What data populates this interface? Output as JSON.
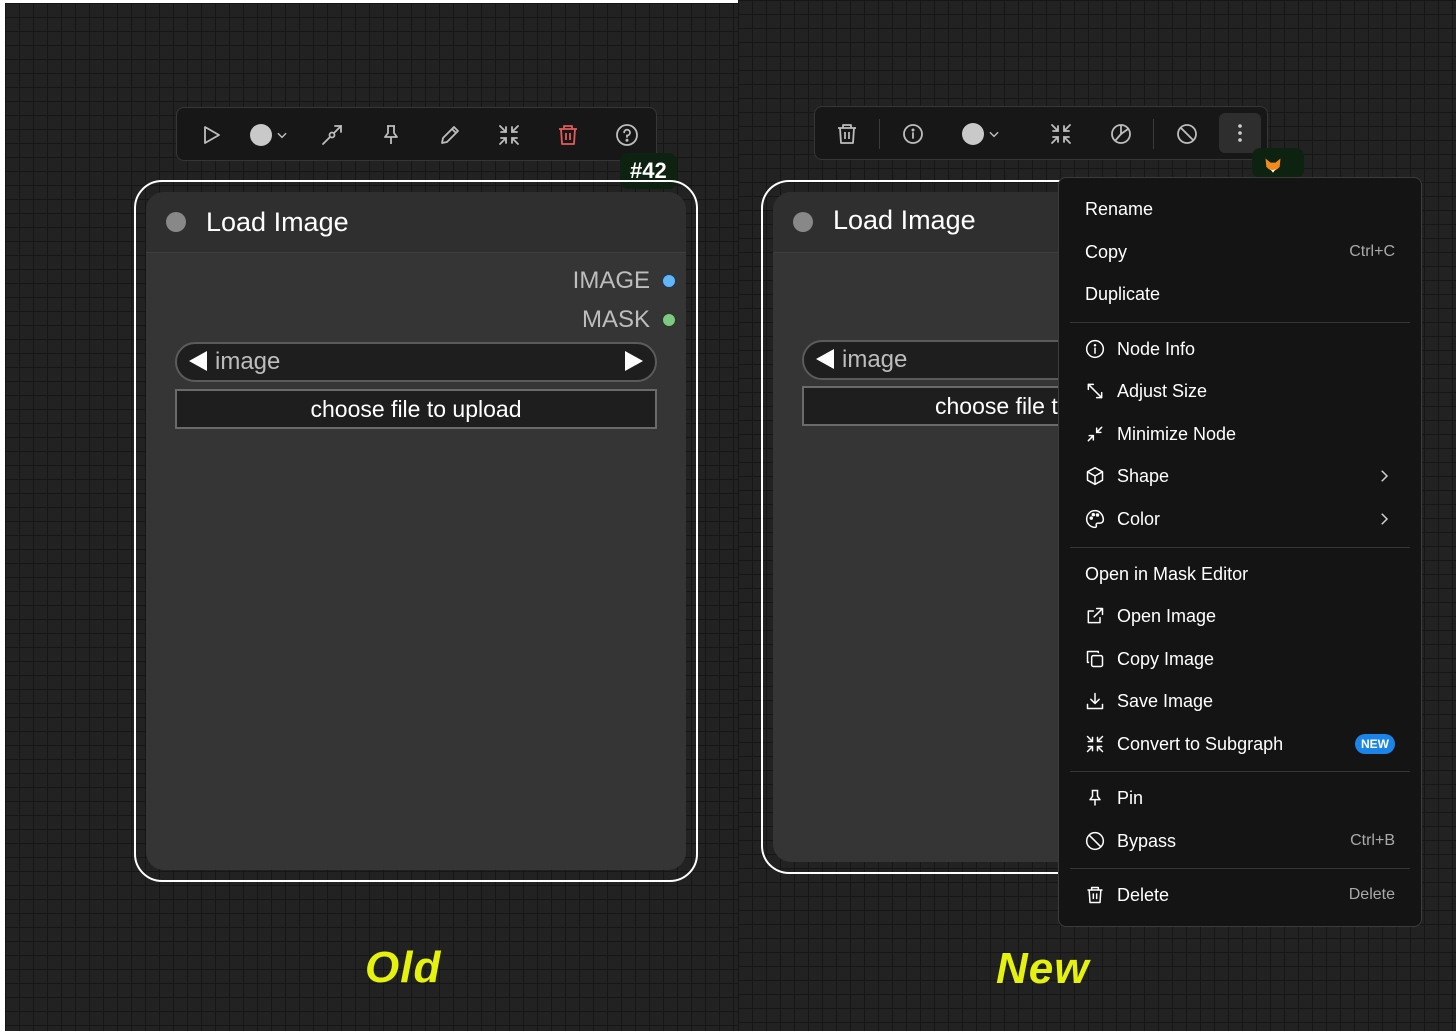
{
  "old": {
    "badge": "#42",
    "node": {
      "title": "Load Image",
      "outputs": [
        {
          "label": "IMAGE",
          "color": "#64b5f6"
        },
        {
          "label": "MASK",
          "color": "#81c784"
        }
      ],
      "combo_label": "image",
      "upload_label": "choose file to upload"
    },
    "caption": "Old",
    "toolbar_icons": [
      "play-icon",
      "color-circle-icon",
      "pen-link-icon",
      "pin-icon",
      "pencil-icon",
      "collapse-icon",
      "trash-icon",
      "help-icon"
    ]
  },
  "new": {
    "node": {
      "title": "Load Image",
      "combo_label": "image",
      "upload_label": "choose file to upload"
    },
    "caption": "New",
    "toolbar_icons": [
      "trash-icon",
      "info-icon",
      "color-circle-icon",
      "collapse-icon",
      "palette-icon",
      "bypass-icon",
      "more-vertical-icon"
    ],
    "menu": {
      "rename": "Rename",
      "copy": "Copy",
      "copy_shortcut": "Ctrl+C",
      "duplicate": "Duplicate",
      "node_info": "Node Info",
      "adjust_size": "Adjust Size",
      "minimize_node": "Minimize Node",
      "shape": "Shape",
      "color": "Color",
      "open_mask_editor": "Open in Mask Editor",
      "open_image": "Open Image",
      "copy_image": "Copy Image",
      "save_image": "Save Image",
      "convert_subgraph": "Convert to Subgraph",
      "new_badge": "NEW",
      "pin": "Pin",
      "bypass": "Bypass",
      "bypass_shortcut": "Ctrl+B",
      "delete": "Delete",
      "delete_shortcut": "Delete"
    }
  },
  "colors": {
    "accent_yellow": "#e5f20e",
    "danger_red": "#e45b5b",
    "new_badge_blue": "#1b84e6",
    "badge_green": "#0d2210"
  }
}
